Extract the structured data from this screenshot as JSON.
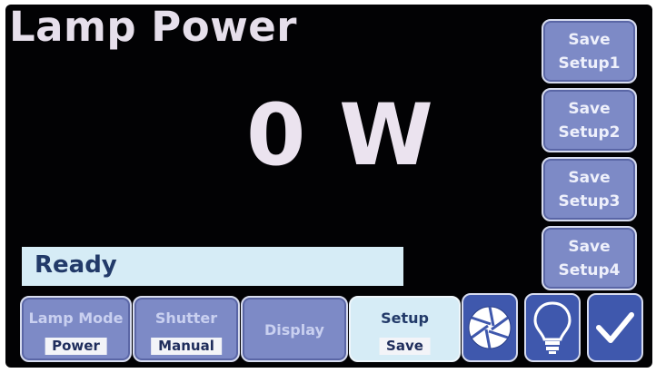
{
  "header": {
    "title": "Lamp Power"
  },
  "reading": {
    "value": "0 W"
  },
  "status": {
    "text": "Ready"
  },
  "save_buttons": [
    {
      "line1": "Save",
      "line2": "Setup1"
    },
    {
      "line1": "Save",
      "line2": "Setup2"
    },
    {
      "line1": "Save",
      "line2": "Setup3"
    },
    {
      "line1": "Save",
      "line2": "Setup4"
    }
  ],
  "tabs": [
    {
      "label": "Lamp Mode",
      "value": "Power"
    },
    {
      "label": "Shutter",
      "value": "Manual"
    },
    {
      "label": "Display"
    },
    {
      "label": "Setup",
      "value": "Save"
    }
  ],
  "icons": [
    "shutter-aperture-icon",
    "lamp-bulb-icon",
    "checkmark-icon"
  ],
  "colors": {
    "background": "#020204",
    "button": "#7d8ac6",
    "active": "#d6ecf6",
    "icon_button": "#3f58ad",
    "text_light": "#ebe3ef",
    "text_dark": "#223a69"
  }
}
